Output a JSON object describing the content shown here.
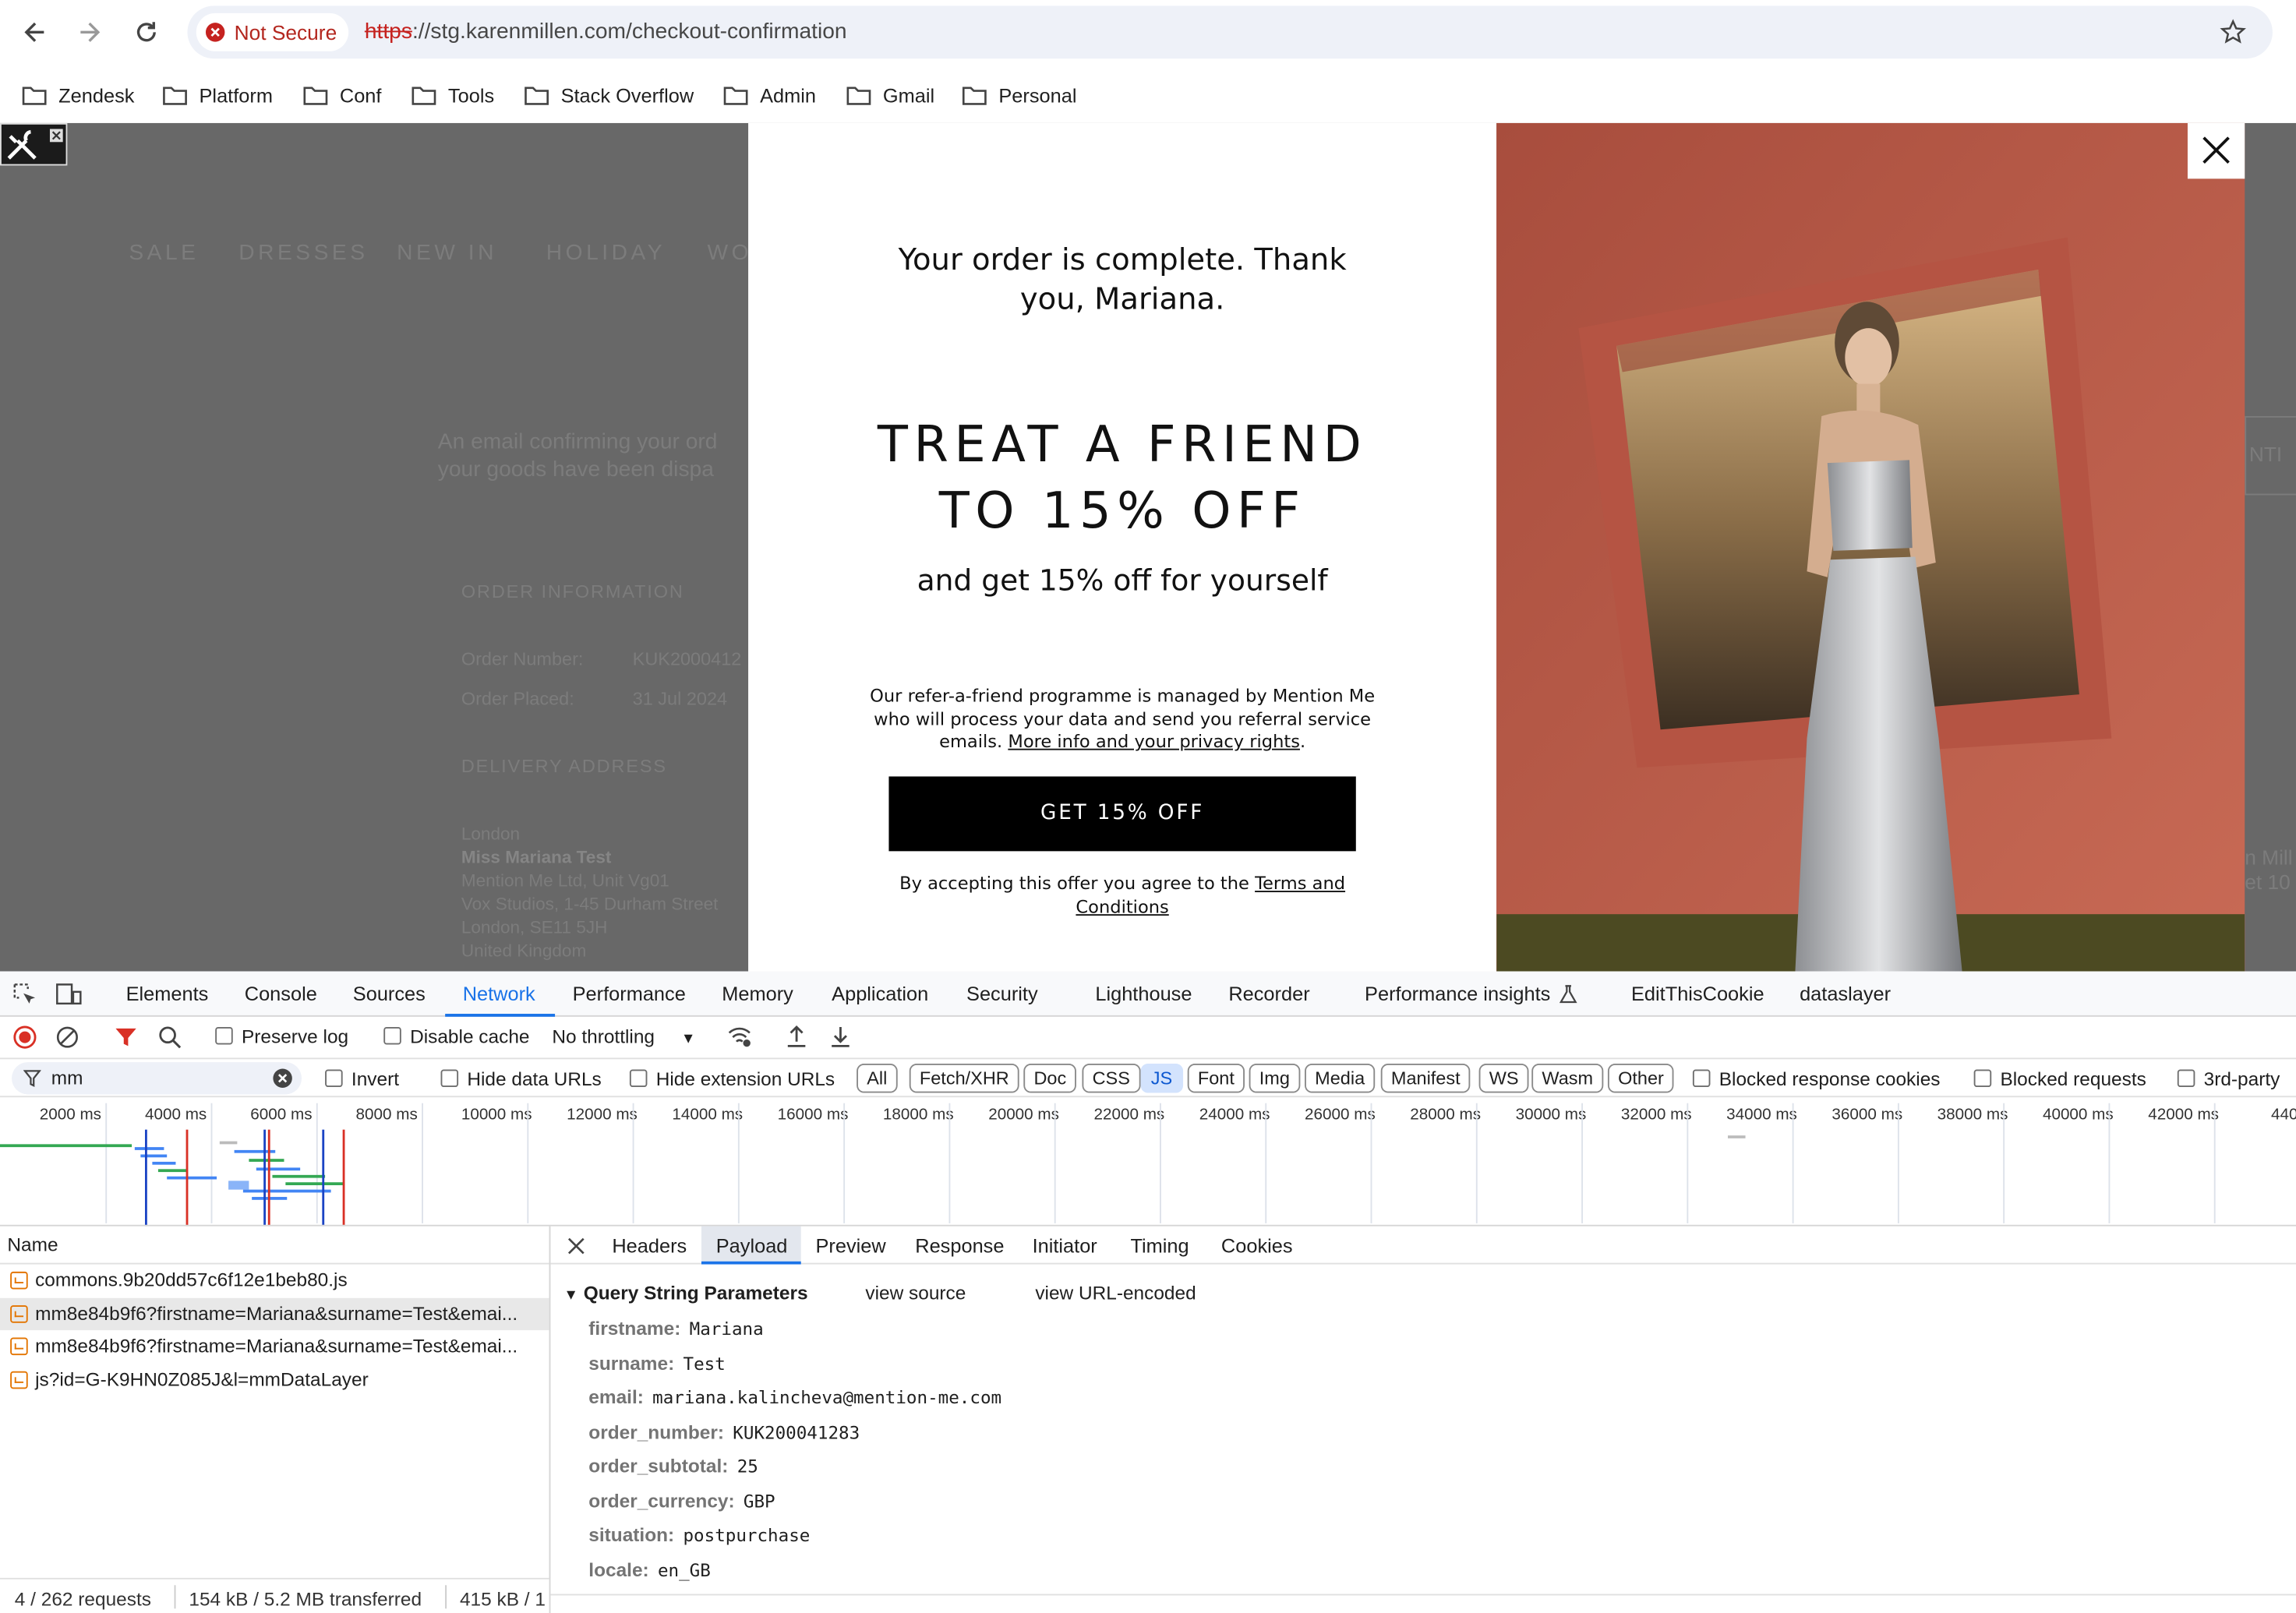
{
  "browser": {
    "security_label": "Not Secure",
    "url_scheme": "https",
    "url_rest": "://stg.karenmillen.com/checkout-confirmation",
    "bookmarks": [
      "Zendesk",
      "Platform",
      "Conf",
      "Tools",
      "Stack Overflow",
      "Admin",
      "Gmail",
      "Personal"
    ]
  },
  "page": {
    "nav": [
      "SALE",
      "DRESSES",
      "NEW IN",
      "HOLIDAY",
      "WO"
    ],
    "email_line1": "An email confirming your ord",
    "email_line2": "your goods have been dispa",
    "order_info_heading": "ORDER INFORMATION",
    "order_number_label": "Order Number:",
    "order_number_value": "KUK2000412",
    "order_placed_label": "Order Placed:",
    "order_placed_value": "31 Jul 2024",
    "delivery_heading": "DELIVERY ADDRESS",
    "address": [
      "London",
      "Miss Mariana Test",
      "Mention Me Ltd, Unit Vg01",
      "Vox Studios, 1-45 Durham Street",
      "London, SE11 5JH",
      "United Kingdom"
    ],
    "right_cut_1": "NTI",
    "right_cut_2": "n Mill",
    "right_cut_3": "et 10"
  },
  "modal": {
    "thank_you_line1": "Your order is complete. Thank",
    "thank_you_line2": "you, Mariana.",
    "headline_line1": "TREAT A FRIEND",
    "headline_line2": "TO 15% OFF",
    "subhead": "and get 15% off for yourself",
    "body_line1": "Our refer-a-friend programme is managed by Mention Me",
    "body_line2": "who will process your data and send you referral service",
    "body_line3_prefix": "emails. ",
    "privacy_link": "More info and your privacy rights",
    "body_line3_suffix": ".",
    "cta": "GET 15% OFF",
    "terms_prefix": "By accepting this offer you agree to the ",
    "terms_link_1": "Terms and",
    "terms_link_2": "Conditions"
  },
  "devtools": {
    "tabs": [
      "Elements",
      "Console",
      "Sources",
      "Network",
      "Performance",
      "Memory",
      "Application",
      "Security",
      "Lighthouse",
      "Recorder",
      "Performance insights",
      "EditThisCookie",
      "dataslayer"
    ],
    "active_tab": "Network",
    "preserve_log": "Preserve log",
    "disable_cache": "Disable cache",
    "throttling": "No throttling",
    "filter_value": "mm",
    "invert": "Invert",
    "hide_data_urls": "Hide data URLs",
    "hide_extension_urls": "Hide extension URLs",
    "type_filters": [
      "All",
      "Fetch/XHR",
      "Doc",
      "CSS",
      "JS",
      "Font",
      "Img",
      "Media",
      "Manifest",
      "WS",
      "Wasm",
      "Other"
    ],
    "active_type_filter": "JS",
    "blocked_response_cookies": "Blocked response cookies",
    "blocked_requests": "Blocked requests",
    "third_party": "3rd-party",
    "timeline_ticks": [
      "2000 ms",
      "4000 ms",
      "6000 ms",
      "8000 ms",
      "10000 ms",
      "12000 ms",
      "14000 ms",
      "16000 ms",
      "18000 ms",
      "20000 ms",
      "22000 ms",
      "24000 ms",
      "26000 ms",
      "28000 ms",
      "30000 ms",
      "32000 ms",
      "34000 ms",
      "36000 ms",
      "38000 ms",
      "40000 ms",
      "42000 ms",
      "440"
    ],
    "name_header": "Name",
    "requests": [
      "commons.9b20dd57c6f12e1beb80.js",
      "mm8e84b9f6?firstname=Mariana&surname=Test&emai...",
      "mm8e84b9f6?firstname=Mariana&surname=Test&emai...",
      "js?id=G-K9HN0Z085J&l=mmDataLayer"
    ],
    "detail_tabs": [
      "Headers",
      "Payload",
      "Preview",
      "Response",
      "Initiator",
      "Timing",
      "Cookies"
    ],
    "active_detail_tab": "Payload",
    "qs_heading": "Query String Parameters",
    "view_source": "view source",
    "view_url_encoded": "view URL-encoded",
    "params": [
      {
        "key": "firstname:",
        "value": "Mariana"
      },
      {
        "key": "surname:",
        "value": "Test"
      },
      {
        "key": "email:",
        "value": "mariana.kalincheva@mention-me.com"
      },
      {
        "key": "order_number:",
        "value": "KUK200041283"
      },
      {
        "key": "order_subtotal:",
        "value": "25"
      },
      {
        "key": "order_currency:",
        "value": "GBP"
      },
      {
        "key": "situation:",
        "value": "postpurchase"
      },
      {
        "key": "locale:",
        "value": "en_GB"
      }
    ],
    "status": {
      "requests": "4 / 262 requests",
      "transferred": "154 kB / 5.2 MB transferred",
      "resources": "415 kB / 1"
    }
  },
  "colors": {
    "accent": "#1a73e8",
    "error": "#d93025",
    "cta": "#000000"
  }
}
